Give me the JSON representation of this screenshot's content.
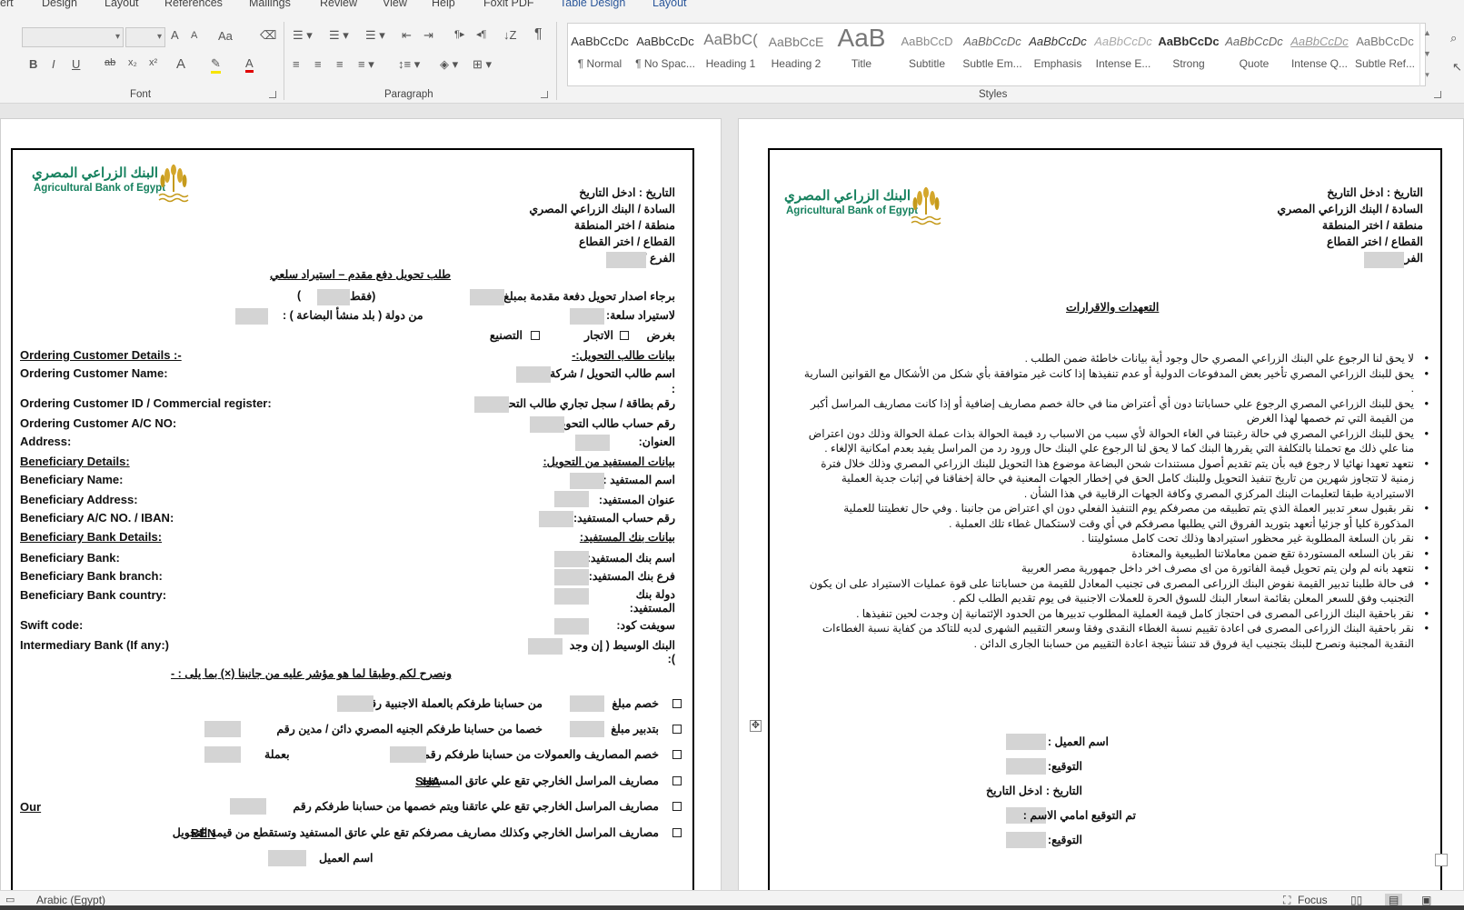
{
  "ribbon": {
    "tabs": [
      "ert",
      "Design",
      "Layout",
      "References",
      "Mailings",
      "Review",
      "View",
      "Help",
      "Foxit PDF",
      "Table Design",
      "Layout"
    ],
    "groups": {
      "font": "Font",
      "paragraph": "Paragraph",
      "styles": "Styles"
    },
    "font_buttons": [
      "B",
      "I",
      "U",
      "ab",
      "x₂",
      "x²",
      "A",
      "A"
    ],
    "font_size_buttons": [
      "A",
      "A",
      "Aa"
    ],
    "styles": [
      {
        "preview": "AaBbCcDc",
        "name": "¶ Normal"
      },
      {
        "preview": "AaBbCcDc",
        "name": "¶ No Spac..."
      },
      {
        "preview": "AaBbC(",
        "name": "Heading 1"
      },
      {
        "preview": "AaBbCcE",
        "name": "Heading 2"
      },
      {
        "preview": "AaB",
        "name": "Title"
      },
      {
        "preview": "AaBbCcD",
        "name": "Subtitle"
      },
      {
        "preview": "AaBbCcDc",
        "name": "Subtle Em..."
      },
      {
        "preview": "AaBbCcDc",
        "name": "Emphasis"
      },
      {
        "preview": "AaBbCcDc",
        "name": "Intense E..."
      },
      {
        "preview": "AaBbCcDc",
        "name": "Strong"
      },
      {
        "preview": "AaBbCcDc",
        "name": "Quote"
      },
      {
        "preview": "AaBbCcDc",
        "name": "Intense Q..."
      },
      {
        "preview": "AaBbCcDc",
        "name": "Subtle Ref..."
      }
    ]
  },
  "left_page": {
    "logo": {
      "ar": "البنك الزراعي المصري",
      "en": "Agricultural Bank of Egypt"
    },
    "header": [
      "التاريخ : ادخل التاريخ",
      "السادة / البنك الزراعي المصري",
      "منطقة / اختر المنطقة",
      "القطاع / اختر القطاع",
      "الفرع /"
    ],
    "title": "طلب تحويل دفع مقدم – استيراد سلعي",
    "line_amount": "برجاء اصدار تحويل دفعة مقدمة بمبلغ",
    "line_faqat_open": "(فقط",
    "line_faqat_close": ")",
    "line_import": "لاستيراد سلعة:",
    "line_country": "من دولة ( بلد منشأ البضاعة ) :",
    "line_purpose": "بغرض",
    "opt_trade": "الاتجار",
    "opt_manufacture": "التصنيع",
    "sec_ordering_ar": "بيانات طالب التحويل:-",
    "sec_ordering_en": "Ordering Customer Details :-",
    "ordering_name_ar": "اسم طالب التحويل / شركة",
    "ordering_name_colon": ":",
    "ordering_name_en": "Ordering Customer Name:",
    "ordering_id_ar": "رقم بطاقة / سجل تجاري طالب التحويل",
    "ordering_id_en": "Ordering Customer ID / Commercial register:",
    "ordering_acc_ar": "رقم حساب طالب التحويل :",
    "ordering_acc_en": "Ordering Customer A/C NO:",
    "address_ar": "العنوان:",
    "address_en": "Address:",
    "sec_benef_ar": "بيانات المستفيد من التحويل:",
    "sec_benef_en": "Beneficiary Details:",
    "benef_name_ar": "اسم المستفيد :",
    "benef_name_en": "Beneficiary Name:",
    "benef_addr_ar": "عنوان المستفيد:",
    "benef_addr_en": "Beneficiary Address:",
    "benef_acc_ar": "رقم حساب المستفيد:",
    "benef_acc_en": "Beneficiary A/C NO. / IBAN:",
    "sec_bank_ar": "بيانات بنك المستفيد:",
    "sec_bank_en": "Beneficiary Bank Details:",
    "bank_ar": "اسم بنك المستفيد:",
    "bank_en": "Beneficiary Bank:",
    "branch_ar": "فرع بنك المستفيد:",
    "branch_en": "Beneficiary Bank branch:",
    "country_ar_1": "دولة بنك",
    "country_ar_2": "المستفيد:",
    "country_en": "Beneficiary Bank country:",
    "swift_ar": "سويفت كود:",
    "swift_en": "Swift code:",
    "inter_ar": "البنك الوسيط ( إن وجد",
    "inter_ar_2": "):",
    "inter_en": "Intermediary Bank (If any:)",
    "instruction": "ونصرح لكم وطبقا لما هو مؤشر عليه من جانبنا (×) بما يلى : -",
    "opt1_a": "خصم مبلغ",
    "opt1_b": "من حسابنا طرفكم بالعملة الاجنبية رقم :",
    "opt2_a": "بتدبير مبلغ",
    "opt2_b": "خصما من حسابنا طرفكم الجنيه المصري  دائن / مدين رقم",
    "opt3_a": "خصم المصاريف والعمولات من حسابنا طرفكم رقم",
    "opt3_b": "بعملة",
    "opt4": "مصاريف المراسل الخارجي تقع علي عاتق المستفيد",
    "opt4_tag": "SHA",
    "opt5": "مصاريف المراسل الخارجي تقع علي عاتقنا ويتم خصمها من حسابنا طرفكم رقم",
    "opt5_tag": "Our",
    "opt6": "مصاريف المراسل الخارجي وكذلك مصاريف مصرفكم تقع علي عاتق المستفيد وتستقطع من قيمة التحويل",
    "opt6_tag": "BEN",
    "client_name": "اسم العميل"
  },
  "right_page": {
    "logo": {
      "ar": "البنك الزراعي المصري",
      "en": "Agricultural Bank of Egypt"
    },
    "header": [
      "التاريخ : ادخل التاريخ",
      "السادة / البنك الزراعي المصري",
      "منطقة / اختر المنطقة",
      "القطاع / اختر القطاع",
      "الفرع /"
    ],
    "title": "التعهدات والاقرارات",
    "bullets": [
      "لا يحق لنا الرجوع علي البنك الزراعي المصري حال وجود أية بيانات خاطئة ضمن الطلب .",
      "يحق للبنك الزراعي المصري تأخير بعض المدفوعات الدولية أو عدم تنفيذها إذا كانت غير متوافقة بأي شكل من الأشكال مع القوانين السارية .",
      "يحق للبنك الزراعي المصري الرجوع علي حساباتنا دون أي أعتراض منا في حالة خصم مصاريف إضافية أو إذا كانت مصاريف المراسل أكبر من القيمة التي تم خصمها لهذا الغرض",
      "يحق للبنك الزراعي المصري في حالة رغبتنا في الغاء الحوالة لأي سبب من الاسباب رد قيمة الحوالة بذات عملة الحوالة وذلك دون اعتراض منا علي ذلك مع تحملنا بالتكلفة التي يقررها البنك كما لا يحق لنا الرجوع علي البنك حال ورود رد من المراسل يفيد بعدم امكانية الإلغاء .",
      "نتعهد تعهدا نهائيا لا رجوع فيه بأن يتم تقديم أصول مستندات شحن البضاعة موضوع هذا التحويل للبنك الزراعي المصري وذلك خلال فترة زمنية لا تتجاوز شهرين من تاريخ تنفيذ التحويل وللبنك كامل الحق في إخطار الجهات المعنية في حالة إخفاقنا في إثبات جدية العملية الاستيرادية طبقا لتعليمات البنك المركزي المصري وكافة الجهات الرقابية في هذا الشأن .",
      "نقر بقبول سعر تدبير العملة الذي يتم تطبيقه من مصرفكم يوم التنفيذ الفعلي دون اي اعتراض من جانبنا . وفي حال تغطيتنا للعملية المذكورة كليا أو جزئيا أتعهد بتوريد الفروق التي يطلبها مصرفكم في أي وقت لاستكمال غطاء تلك العملية .",
      "نقر بان السلعة المطلوبة غير محظور استيرادها وذلك تحت كامل مسئوليتنا .",
      "نقر بان السلعه المستوردة تقع ضمن معاملاتنا الطبيعية والمعتادة",
      "نتعهد بانه لم ولن يتم تحويل قيمة الفاتورة من اى مصرف اخر داخل جمهورية مصر العربية",
      "فى حالة طلبنا تدبير القيمة نفوض البنك الزراعى المصرى فى تجنيب المعادل للقيمة من حساباتنا على قوة عمليات الاستيراد على ان يكون التجنيب وفق للسعر المعلن بقائمة اسعار البنك للسوق الحرة للعملات الاجنبية فى يوم تقديم الطلب لكم .",
      "نقر باحقية البنك الزراعى المصرى فى احتجاز كامل قيمة العملية المطلوب تدبيرها من الحدود الإئتمانية إن وجدت لحين تنفيذها .",
      "نقر باحقية البنك الزراعى المصرى فى اعادة تقييم نسبة الغطاء النقدى وفقا وسعر التقييم الشهرى لديه للتاكد من كفاية نسبة الغطاءات النقدية المجنبة ونصرح للبنك بتجنيب اية فروق قد تنشأ نتيجة اعادة التقييم من حسابنا الجارى الدائن ."
    ],
    "sig_client": "اسم العميل :",
    "sig_sign": "التوقيع:",
    "sig_date_label": "التاريخ :",
    "sig_date_value": "ادخل التاريخ",
    "sig_signed_before": "تم التوقيع امامي الاسم :",
    "sig_sign2": "التوقيع:"
  },
  "status": {
    "language": "Arabic (Egypt)",
    "focus": "Focus"
  },
  "colors": {
    "bank_green": "#16815e",
    "field_gray": "#d4d4d4",
    "ribbon_bg": "#f3f3f3",
    "accent_blue": "#2b579a"
  }
}
